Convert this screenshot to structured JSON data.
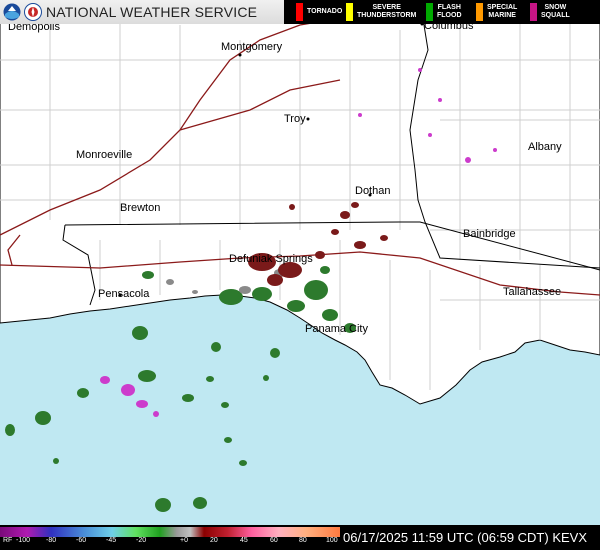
{
  "header": {
    "agency": "NATIONAL WEATHER SERVICE",
    "legend": [
      {
        "label_line1": "TORNADO",
        "label_line2": "",
        "color": "#ff0000"
      },
      {
        "label_line1": "SEVERE",
        "label_line2": "THUNDERSTORM",
        "color": "#ffff00"
      },
      {
        "label_line1": "FLASH",
        "label_line2": "FLOOD",
        "color": "#00aa00"
      },
      {
        "label_line1": "SPECIAL",
        "label_line2": "MARINE",
        "color": "#ff9900"
      },
      {
        "label_line1": "SNOW",
        "label_line2": "SQUALL",
        "color": "#c71585"
      }
    ]
  },
  "map": {
    "cities": [
      "Demopolis",
      "Montgomery",
      "Columbus",
      "Troy",
      "Monroeville",
      "Albany",
      "Dothan",
      "Brewton",
      "Bainbridge",
      "Defuniak Springs",
      "Pensacola",
      "Tallahassee",
      "Panama City"
    ],
    "colors": {
      "water": "#bfe8f2",
      "land": "#ffffff",
      "county": "#cfcfcf",
      "state": "#000000",
      "highway": "#8b1a1a"
    }
  },
  "footer": {
    "scale_labels": [
      "RF",
      "-100",
      "-80",
      "-60",
      "-45",
      "-20",
      "+0",
      "20",
      "45",
      "60",
      "80",
      "100"
    ],
    "timestamp": "06/17/2025 11:59 UTC (06:59 CDT) KEVX"
  }
}
